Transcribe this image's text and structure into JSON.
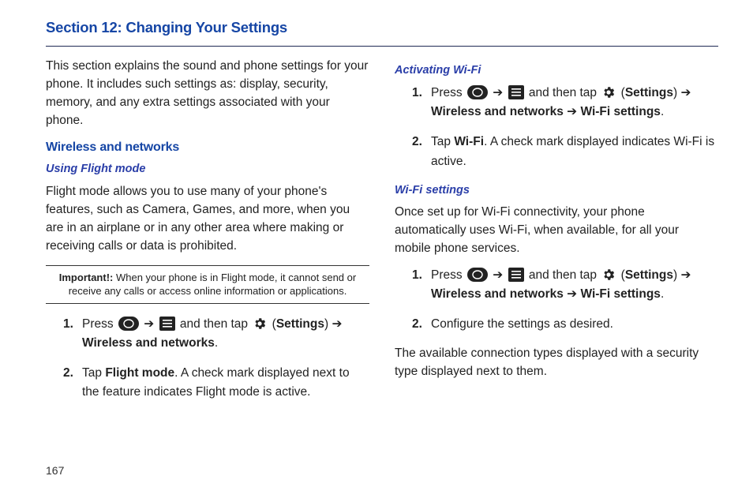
{
  "pageNumber": "167",
  "sectionTitle": "Section 12: Changing Your Settings",
  "intro": "This section explains the sound and phone settings for your phone. It includes such settings as: display, security, memory, and any extra settings associated with your phone.",
  "headings": {
    "wireless": "Wireless and networks",
    "flightMode": "Using Flight mode",
    "activatingWifi": "Activating Wi-Fi",
    "wifiSettings": "Wi-Fi settings"
  },
  "flightMode": {
    "desc": "Flight mode allows you to use many of your phone's features, such as Camera, Games, and more, when you are in an airplane or in any other area where making or receiving calls or data is prohibited.",
    "noteLead": "Important!:",
    "noteBody": " When your phone is in Flight mode, it cannot send or receive any calls or access online information or applications."
  },
  "labels": {
    "press": "Press ",
    "andThenTap": " and then tap ",
    "settings": "Settings",
    "arrowTo": " ➔ ",
    "wirelessNetworks": "Wireless and networks",
    "wifiSettings": "Wi-Fi settings",
    "tap": "Tap ",
    "wifi": "Wi-Fi",
    "flightModeWord": "Flight mode",
    "period": ".",
    "num1": "1.",
    "num2": "2."
  },
  "flightSteps": {
    "s2tail": ". A check mark displayed next to the feature indicates Flight mode is active."
  },
  "activate": {
    "s2tail": ". A check mark displayed indicates Wi-Fi is active."
  },
  "wifi": {
    "desc": "Once set up for Wi-Fi connectivity, your phone automatically uses Wi-Fi, when available, for all your mobile phone services.",
    "s2": "Configure the settings as desired.",
    "tail": "The available connection types displayed with a security type displayed next to them."
  }
}
